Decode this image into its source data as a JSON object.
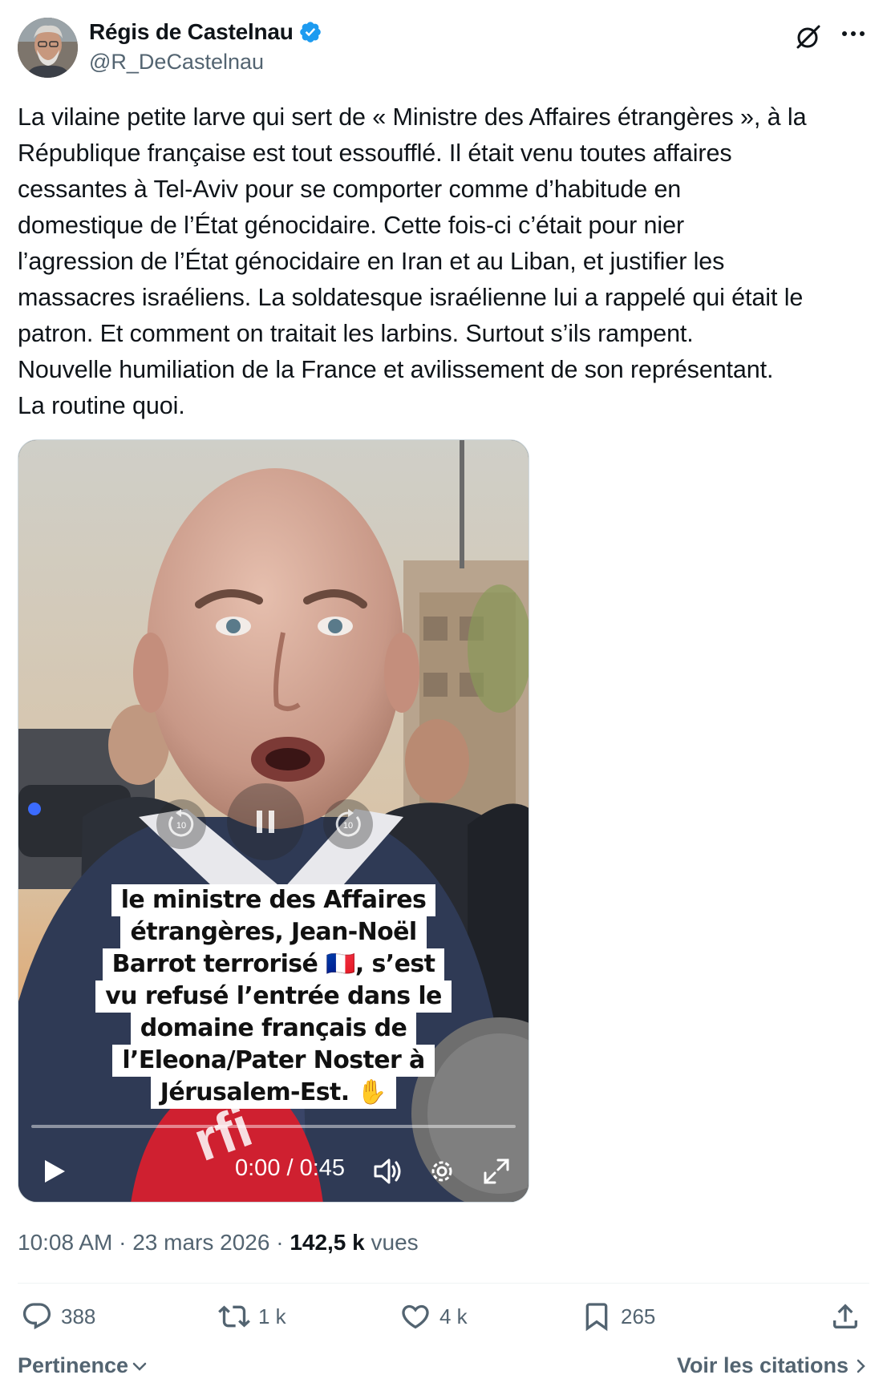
{
  "author": {
    "display_name": "Régis de Castelnau",
    "handle": "@R_DeCastelnau",
    "verified": true
  },
  "icons": {
    "verified": "verified-badge-icon",
    "grok": "grok-icon",
    "more": "more-icon",
    "reply": "reply-icon",
    "retweet": "retweet-icon",
    "like": "like-icon",
    "bookmark": "bookmark-icon",
    "share": "share-icon"
  },
  "tweet": {
    "text": "La vilaine petite larve qui sert de « Ministre des Affaires étrangères », à la\nRépublique française est tout essoufflé. Il était venu toutes affaires\ncessantes à Tel-Aviv pour se comporter comme d’habitude en\ndomestique de l’État génocidaire. Cette fois-ci c’était pour nier\nl’agression de l’État génocidaire en Iran et au Liban, et justifier les\nmassacres israéliens. La soldatesque israélienne lui a rappelé qui était le\npatron. Et comment on traitait les larbins. Surtout s’ils rampent.\nNouvelle humiliation de la France et avilissement de son représentant.\nLa routine quoi."
  },
  "video": {
    "caption_lines": [
      "le ministre des Affaires",
      "étrangères, Jean-Noël",
      "Barrot terrorisé 🇫🇷, s’est",
      "vu refusé l’entrée dans le",
      "domaine français de",
      "l’Eleona/Pater Noster à",
      "Jérusalem-Est. ✋"
    ],
    "time_display": "0:00 / 0:45",
    "progress": 0
  },
  "meta": {
    "time": "10:08 AM",
    "sep1": " · ",
    "date": "23 mars 2026",
    "sep2": " · ",
    "views_count": "142,5 k",
    "views_label": " vues"
  },
  "actions": {
    "replies": "388",
    "reposts": "1 k",
    "likes": "4 k",
    "bookmarks": "265"
  },
  "footer": {
    "sort_label": "Pertinence",
    "quotes_label": "Voir les citations"
  },
  "colors": {
    "verified_blue": "#1d9bf0",
    "text_primary": "#0f1419",
    "text_secondary": "#536471"
  }
}
